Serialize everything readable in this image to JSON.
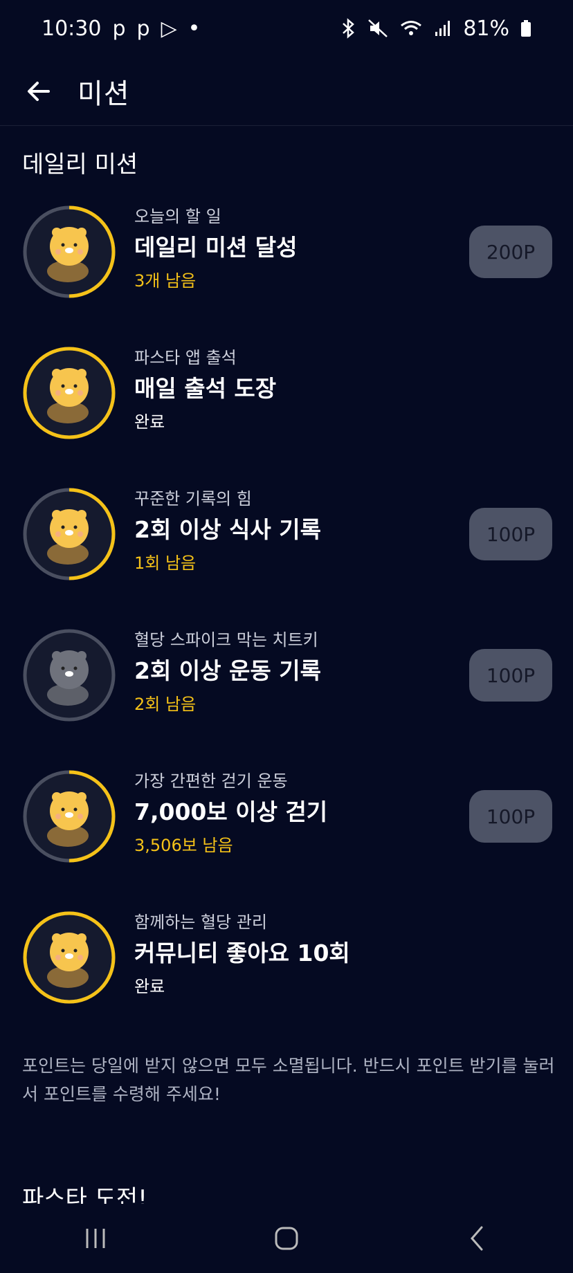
{
  "status_bar": {
    "time": "10:30",
    "notif_icons": [
      "p",
      "p",
      "▷",
      "•"
    ],
    "battery": "81%"
  },
  "header": {
    "title": "미션"
  },
  "daily": {
    "title": "데일리 미션",
    "missions": [
      {
        "subtitle": "오늘의 할 일",
        "title": "데일리 미션 달성",
        "status": "3개 남음",
        "state": "remaining",
        "points": "200P",
        "progress": 0.5,
        "avatar_icon": "cheering-lion-icon"
      },
      {
        "subtitle": "파스타 앱 출석",
        "title": "매일 출석 도장",
        "status": "완료",
        "state": "done",
        "points": "",
        "progress": 1.0,
        "avatar_icon": "stamping-lion-icon"
      },
      {
        "subtitle": "꾸준한 기록의 힘",
        "title": "2회 이상 식사 기록",
        "status": "1회 남음",
        "state": "remaining",
        "points": "100P",
        "progress": 0.5,
        "avatar_icon": "eating-lion-icon"
      },
      {
        "subtitle": "혈당 스파이크 막는 치트키",
        "title": "2회 이상 운동 기록",
        "status": "2회 남음",
        "state": "remaining",
        "points": "100P",
        "progress": 0.0,
        "avatar_icon": "exercising-lion-icon"
      },
      {
        "subtitle": "가장 간편한 걷기 운동",
        "title": "7,000보 이상 걷기",
        "status": "3,506보 남음",
        "state": "remaining",
        "points": "100P",
        "progress": 0.5,
        "avatar_icon": "walking-lion-icon"
      },
      {
        "subtitle": "함께하는 혈당 관리",
        "title": "커뮤니티 좋아요 10회",
        "status": "완료",
        "state": "done",
        "points": "",
        "progress": 1.0,
        "avatar_icon": "heart-lion-icon"
      }
    ]
  },
  "notice": "포인트는 당일에 받지 않으면 모두 소멸됩니다. 반드시 포인트 받기를 눌러서 포인트를 수령해 주세요!",
  "challenge": {
    "title": "파스타 도전!"
  },
  "colors": {
    "background": "#050a22",
    "accent": "#f5c218",
    "button": "#4d5366",
    "ring_track": "#4a4f60"
  }
}
